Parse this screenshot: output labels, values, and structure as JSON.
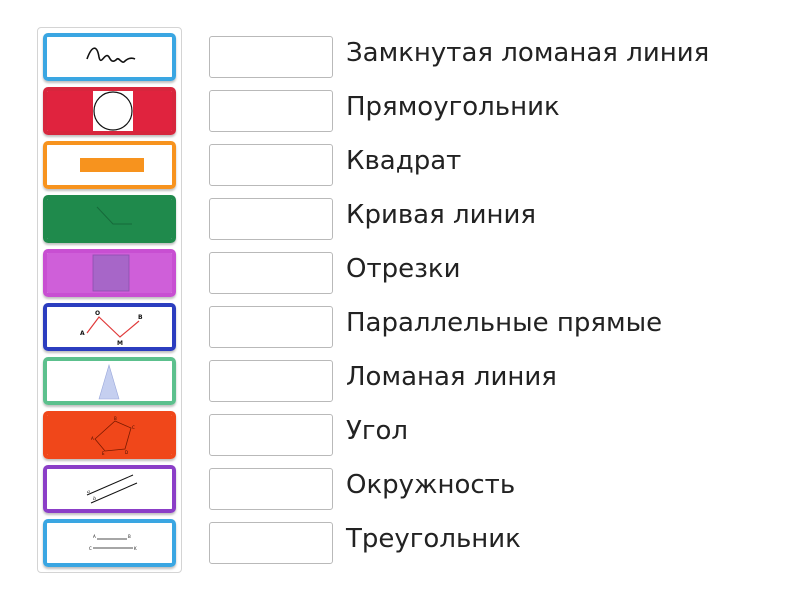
{
  "labels": [
    "Замкнутая ломаная линия",
    "Прямоугольник",
    "Квадрат",
    "Кривая линия",
    "Отрезки",
    "Параллельные прямые",
    "Ломаная линия",
    "Угол",
    "Окружность",
    "Треугольник"
  ],
  "tiles": [
    {
      "image": "curve-line-icon",
      "color": "#3aa6e2"
    },
    {
      "image": "circle-icon",
      "color": "#d7263d"
    },
    {
      "image": "rectangle-icon",
      "color": "#f7931e"
    },
    {
      "image": "angle-icon",
      "color": "#1f8a4c"
    },
    {
      "image": "square-icon",
      "color": "#c84fd2"
    },
    {
      "image": "polyline-icon",
      "color": "#2b3dbf"
    },
    {
      "image": "triangle-icon",
      "color": "#5cc08d"
    },
    {
      "image": "closed-polyline-icon",
      "color": "#f0471a"
    },
    {
      "image": "parallel-lines-icon",
      "color": "#8b3ec7"
    },
    {
      "image": "segments-icon",
      "color": "#3aa6e2"
    }
  ],
  "tile_text": {
    "polyline": {
      "o": "O",
      "b": "B",
      "a": "A",
      "m": "M"
    },
    "parallel": {
      "a": "a",
      "b": "b"
    },
    "segments": {
      "a": "A",
      "b": "B",
      "c": "C",
      "k": "K"
    },
    "pentagon": {
      "b": "B",
      "c": "C",
      "d": "D",
      "e": "E",
      "a": "A"
    }
  }
}
